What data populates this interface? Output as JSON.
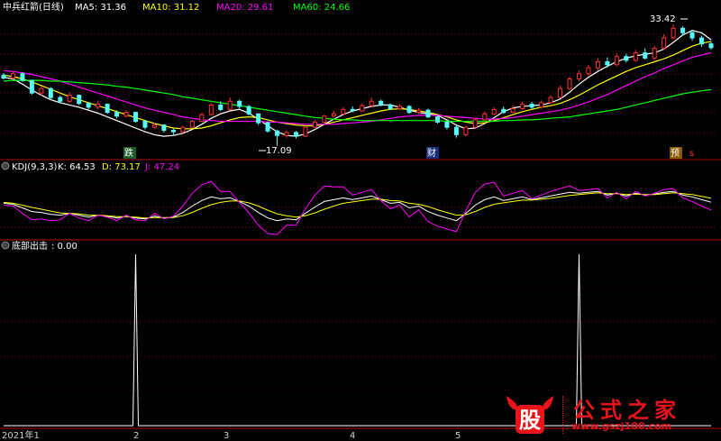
{
  "header": {
    "title": "中兵红箭(日线)",
    "ma": [
      {
        "label": "MA5: 31.36",
        "color": "#ffffff"
      },
      {
        "label": "MA10: 31.12",
        "color": "#ffff00"
      },
      {
        "label": "MA20: 29.61",
        "color": "#ff00ff"
      },
      {
        "label": "MA60: 24.66",
        "color": "#00ff00"
      }
    ]
  },
  "kdj": {
    "title": "KDJ(9,3,3)",
    "k": "K: 64.53",
    "d": "D: 73.17",
    "j": "J: 47.24"
  },
  "bottom": {
    "title": "底部出击",
    "value": ": 0.00"
  },
  "annotations": {
    "high": "33.42",
    "low": "17.09",
    "tag_die": "跌",
    "tag_cai": "财",
    "tag_yu": "预",
    "tag_s": "s"
  },
  "xaxis": [
    "2021年1",
    "2",
    "3",
    "4",
    "5"
  ],
  "watermark": {
    "logo": "股",
    "text": "公式之家",
    "url": "www.gszj100.com"
  },
  "colors": {
    "up": "#ff3232",
    "down": "#54ffff",
    "ma5": "#ffffff",
    "ma10": "#ffff00",
    "ma20": "#ff00ff",
    "ma60": "#00ff00",
    "k": "#ffffff",
    "d": "#ffff00",
    "j": "#ff00ff",
    "grid": "#800000",
    "divider": "#b40000"
  },
  "chart_data": [
    {
      "type": "candlestick",
      "title": "中兵红箭(日线)",
      "ylim": [
        15.5,
        35
      ],
      "series": [
        {
          "name": "MA5",
          "values": [
            26.3,
            26.1,
            25.4,
            24.6,
            23.9,
            23.3,
            22.9,
            22.6,
            22.3,
            21.9,
            21.5,
            21.0,
            20.5,
            20.0,
            19.5,
            19.0,
            18.6,
            18.4,
            18.5,
            18.8,
            19.3,
            20.0,
            20.8,
            21.4,
            21.8,
            22.0,
            21.5,
            20.7,
            19.8,
            19.0,
            18.5,
            18.4,
            18.7,
            19.3,
            20.0,
            20.7,
            21.3,
            21.8,
            22.1,
            22.4,
            22.6,
            22.6,
            22.3,
            21.9,
            21.6,
            21.4,
            21.2,
            20.6,
            19.9,
            19.4,
            19.5,
            20.1,
            20.9,
            21.7,
            22.2,
            22.4,
            22.5,
            22.6,
            22.9,
            23.4,
            24.3,
            25.4,
            26.3,
            27.1,
            27.8,
            28.4,
            28.9,
            29.2,
            29.4,
            29.6,
            30.1,
            31.0,
            32.0,
            32.6,
            32.3,
            31.36
          ]
        },
        {
          "name": "MA10",
          "values": [
            26.6,
            26.4,
            26.1,
            25.7,
            25.2,
            24.7,
            24.2,
            23.7,
            23.3,
            22.9,
            22.5,
            22.1,
            21.7,
            21.3,
            20.9,
            20.5,
            20.1,
            19.8,
            19.5,
            19.4,
            19.4,
            19.5,
            19.8,
            20.2,
            20.6,
            20.9,
            21.0,
            20.9,
            20.6,
            20.3,
            20.1,
            19.9,
            19.8,
            19.8,
            20.0,
            20.3,
            20.6,
            20.9,
            21.2,
            21.5,
            21.8,
            22.0,
            22.1,
            22.0,
            21.8,
            21.6,
            21.3,
            21.0,
            20.6,
            20.3,
            20.1,
            20.2,
            20.5,
            20.9,
            21.3,
            21.7,
            22.0,
            22.3,
            22.5,
            22.8,
            23.3,
            23.9,
            24.6,
            25.3,
            25.9,
            26.5,
            27.1,
            27.6,
            28.0,
            28.4,
            28.8,
            29.3,
            29.9,
            30.5,
            30.9,
            31.12
          ]
        },
        {
          "name": "MA20",
          "values": [
            27.2,
            27.1,
            26.9,
            26.7,
            26.4,
            26.1,
            25.8,
            25.4,
            25.0,
            24.6,
            24.2,
            23.8,
            23.4,
            23.0,
            22.6,
            22.2,
            21.9,
            21.6,
            21.3,
            21.0,
            20.8,
            20.6,
            20.5,
            20.4,
            20.4,
            20.4,
            20.4,
            20.4,
            20.3,
            20.3,
            20.2,
            20.1,
            20.0,
            20.0,
            20.0,
            20.0,
            20.1,
            20.2,
            20.3,
            20.4,
            20.6,
            20.8,
            21.0,
            21.1,
            21.2,
            21.2,
            21.2,
            21.1,
            21.0,
            20.9,
            20.8,
            20.7,
            20.7,
            20.8,
            20.9,
            21.1,
            21.3,
            21.5,
            21.7,
            21.9,
            22.2,
            22.6,
            23.0,
            23.5,
            24.0,
            24.6,
            25.2,
            25.8,
            26.4,
            26.9,
            27.5,
            28.0,
            28.5,
            29.0,
            29.3,
            29.61
          ]
        },
        {
          "name": "MA60",
          "values": [
            25.8,
            25.9,
            25.9,
            25.9,
            25.9,
            25.8,
            25.8,
            25.7,
            25.6,
            25.5,
            25.4,
            25.3,
            25.1,
            25.0,
            24.8,
            24.6,
            24.4,
            24.2,
            24.0,
            23.7,
            23.5,
            23.3,
            23.1,
            22.9,
            22.7,
            22.5,
            22.3,
            22.1,
            21.9,
            21.7,
            21.5,
            21.3,
            21.1,
            20.9,
            20.8,
            20.7,
            20.6,
            20.6,
            20.5,
            20.5,
            20.5,
            20.5,
            20.5,
            20.5,
            20.5,
            20.5,
            20.5,
            20.4,
            20.4,
            20.4,
            20.4,
            20.4,
            20.4,
            20.5,
            20.5,
            20.6,
            20.6,
            20.7,
            20.8,
            20.9,
            21.0,
            21.2,
            21.4,
            21.6,
            21.8,
            22.0,
            22.3,
            22.6,
            22.9,
            23.2,
            23.5,
            23.8,
            24.1,
            24.3,
            24.5,
            24.66
          ]
        }
      ],
      "candles": [
        [
          26.6,
          26.2,
          26.9,
          26.0
        ],
        [
          26.2,
          26.8,
          27.1,
          26.0
        ],
        [
          26.8,
          25.9,
          27.0,
          25.7
        ],
        [
          25.9,
          24.2,
          26.0,
          24.0
        ],
        [
          24.2,
          24.8,
          25.1,
          23.9
        ],
        [
          24.8,
          23.6,
          25.0,
          23.4
        ],
        [
          23.6,
          23.1,
          23.9,
          22.8
        ],
        [
          23.1,
          23.9,
          24.3,
          22.9
        ],
        [
          23.9,
          22.8,
          24.0,
          22.6
        ],
        [
          22.8,
          22.3,
          23.0,
          22.0
        ],
        [
          22.3,
          22.7,
          23.2,
          22.0
        ],
        [
          22.7,
          21.6,
          22.8,
          21.4
        ],
        [
          21.6,
          21.1,
          21.9,
          20.8
        ],
        [
          21.1,
          21.6,
          21.9,
          20.9
        ],
        [
          21.6,
          20.4,
          21.7,
          20.2
        ],
        [
          20.4,
          19.6,
          20.6,
          19.3
        ],
        [
          19.6,
          19.9,
          20.2,
          19.4
        ],
        [
          19.9,
          19.2,
          20.0,
          18.9
        ],
        [
          19.2,
          19.0,
          19.4,
          18.6
        ],
        [
          19.0,
          19.6,
          19.8,
          18.8
        ],
        [
          19.6,
          20.4,
          20.6,
          19.5
        ],
        [
          20.4,
          21.3,
          21.5,
          20.3
        ],
        [
          21.3,
          22.6,
          22.9,
          21.2
        ],
        [
          22.6,
          22.0,
          23.1,
          21.8
        ],
        [
          22.0,
          23.1,
          23.6,
          21.9
        ],
        [
          23.1,
          22.4,
          23.3,
          22.1
        ],
        [
          22.4,
          21.4,
          22.6,
          21.2
        ],
        [
          21.4,
          20.2,
          21.5,
          19.9
        ],
        [
          20.2,
          19.1,
          20.4,
          18.9
        ],
        [
          19.1,
          18.5,
          19.3,
          17.09
        ],
        [
          18.5,
          18.9,
          19.2,
          18.2
        ],
        [
          18.9,
          18.4,
          19.1,
          18.1
        ],
        [
          18.4,
          19.6,
          19.8,
          18.3
        ],
        [
          19.6,
          20.3,
          20.6,
          19.5
        ],
        [
          20.3,
          21.1,
          21.3,
          20.1
        ],
        [
          21.1,
          21.4,
          21.8,
          20.9
        ],
        [
          21.4,
          22.0,
          22.3,
          21.2
        ],
        [
          22.0,
          21.8,
          22.4,
          21.6
        ],
        [
          21.8,
          22.5,
          22.8,
          21.7
        ],
        [
          22.5,
          23.1,
          23.6,
          22.3
        ],
        [
          23.1,
          22.6,
          23.3,
          22.4
        ],
        [
          22.6,
          22.1,
          22.8,
          21.9
        ],
        [
          22.1,
          22.4,
          22.7,
          21.9
        ],
        [
          22.4,
          21.6,
          22.6,
          21.4
        ],
        [
          21.6,
          21.9,
          22.2,
          21.4
        ],
        [
          21.9,
          21.0,
          22.1,
          20.8
        ],
        [
          21.0,
          20.3,
          21.2,
          20.1
        ],
        [
          20.3,
          19.6,
          20.5,
          19.3
        ],
        [
          19.6,
          18.6,
          19.8,
          18.2
        ],
        [
          18.6,
          19.6,
          19.8,
          18.4
        ],
        [
          19.6,
          20.6,
          20.9,
          19.5
        ],
        [
          20.6,
          21.4,
          21.7,
          20.4
        ],
        [
          21.4,
          22.0,
          22.3,
          21.2
        ],
        [
          22.0,
          21.6,
          22.4,
          21.4
        ],
        [
          21.6,
          22.1,
          22.6,
          21.5
        ],
        [
          22.1,
          22.7,
          23.0,
          21.9
        ],
        [
          22.7,
          22.3,
          23.0,
          22.0
        ],
        [
          22.3,
          22.9,
          23.2,
          22.1
        ],
        [
          22.9,
          23.6,
          23.9,
          22.8
        ],
        [
          23.6,
          24.8,
          25.2,
          23.5
        ],
        [
          24.8,
          26.1,
          26.4,
          24.6
        ],
        [
          26.1,
          26.8,
          27.2,
          25.8
        ],
        [
          26.8,
          27.6,
          28.0,
          26.5
        ],
        [
          27.6,
          28.4,
          28.9,
          27.2
        ],
        [
          28.4,
          28.0,
          29.0,
          27.6
        ],
        [
          28.0,
          29.1,
          29.6,
          27.8
        ],
        [
          29.1,
          28.6,
          29.5,
          28.3
        ],
        [
          28.6,
          29.6,
          30.0,
          28.4
        ],
        [
          29.6,
          28.9,
          30.2,
          28.7
        ],
        [
          28.9,
          30.2,
          30.5,
          28.6
        ],
        [
          30.2,
          31.6,
          32.1,
          30.0
        ],
        [
          31.6,
          32.9,
          33.42,
          31.4
        ],
        [
          32.9,
          32.3,
          33.2,
          31.9
        ],
        [
          32.3,
          31.6,
          32.7,
          31.2
        ],
        [
          31.6,
          30.8,
          31.9,
          30.4
        ],
        [
          30.8,
          30.3,
          31.1,
          30.0
        ]
      ]
    },
    {
      "type": "line",
      "title": "KDJ(9,3,3)",
      "ylim": [
        -10,
        120
      ],
      "series": [
        {
          "name": "K",
          "values": [
            62,
            60,
            52,
            44,
            42,
            38,
            36,
            40,
            36,
            32,
            36,
            34,
            30,
            34,
            30,
            28,
            34,
            30,
            32,
            42,
            56,
            68,
            76,
            72,
            74,
            66,
            56,
            42,
            30,
            24,
            28,
            26,
            40,
            54,
            66,
            70,
            74,
            70,
            74,
            78,
            70,
            62,
            64,
            52,
            56,
            44,
            36,
            30,
            24,
            40,
            58,
            70,
            76,
            68,
            72,
            76,
            70,
            74,
            78,
            82,
            86,
            84,
            86,
            88,
            80,
            84,
            78,
            84,
            80,
            82,
            86,
            88,
            80,
            76,
            70,
            64.53
          ]
        },
        {
          "name": "D",
          "values": [
            64,
            62,
            58,
            53,
            49,
            45,
            41,
            40,
            39,
            36,
            36,
            35,
            33,
            33,
            32,
            30,
            31,
            31,
            31,
            35,
            42,
            51,
            59,
            64,
            67,
            67,
            63,
            56,
            47,
            39,
            35,
            32,
            35,
            41,
            49,
            56,
            62,
            65,
            68,
            71,
            71,
            68,
            67,
            62,
            60,
            55,
            48,
            42,
            36,
            37,
            44,
            53,
            60,
            63,
            66,
            69,
            69,
            71,
            73,
            76,
            79,
            81,
            83,
            85,
            83,
            83,
            81,
            82,
            81,
            81,
            83,
            85,
            83,
            81,
            77,
            73.17
          ]
        },
        {
          "name": "J",
          "values": [
            58,
            56,
            40,
            26,
            28,
            24,
            26,
            40,
            30,
            24,
            36,
            32,
            24,
            36,
            26,
            24,
            40,
            28,
            34,
            56,
            84,
            102,
            110,
            88,
            88,
            64,
            42,
            14,
            -4,
            -6,
            14,
            14,
            50,
            80,
            100,
            98,
            98,
            80,
            86,
            92,
            68,
            50,
            58,
            32,
            48,
            22,
            12,
            6,
            0,
            46,
            86,
            104,
            108,
            78,
            84,
            90,
            72,
            80,
            88,
            94,
            100,
            90,
            92,
            94,
            74,
            86,
            72,
            88,
            78,
            84,
            92,
            94,
            74,
            66,
            56,
            47.24
          ]
        }
      ]
    },
    {
      "type": "line",
      "title": "底部出击",
      "ylim": [
        0,
        100
      ],
      "series": [
        {
          "name": "底部出击",
          "values": [
            0,
            0,
            0,
            0,
            0,
            0,
            0,
            0,
            0,
            0,
            0,
            0,
            0,
            0,
            0,
            0,
            0,
            0,
            0,
            0,
            0,
            0,
            0,
            0,
            0,
            0,
            0,
            0,
            0,
            0,
            0,
            0,
            0,
            0,
            0,
            0,
            0,
            0,
            0,
            0,
            0,
            0,
            0,
            0,
            0,
            0,
            0,
            0,
            0,
            0,
            0,
            0,
            0,
            0,
            0,
            0,
            0,
            0,
            0,
            0,
            0,
            0,
            0,
            0,
            0,
            0,
            0,
            0,
            0,
            0,
            0,
            0,
            0,
            0,
            0,
            0
          ]
        },
        {
          "name": "spikes",
          "x_index": [
            14,
            61
          ],
          "values": [
            100,
            100
          ]
        }
      ]
    }
  ]
}
